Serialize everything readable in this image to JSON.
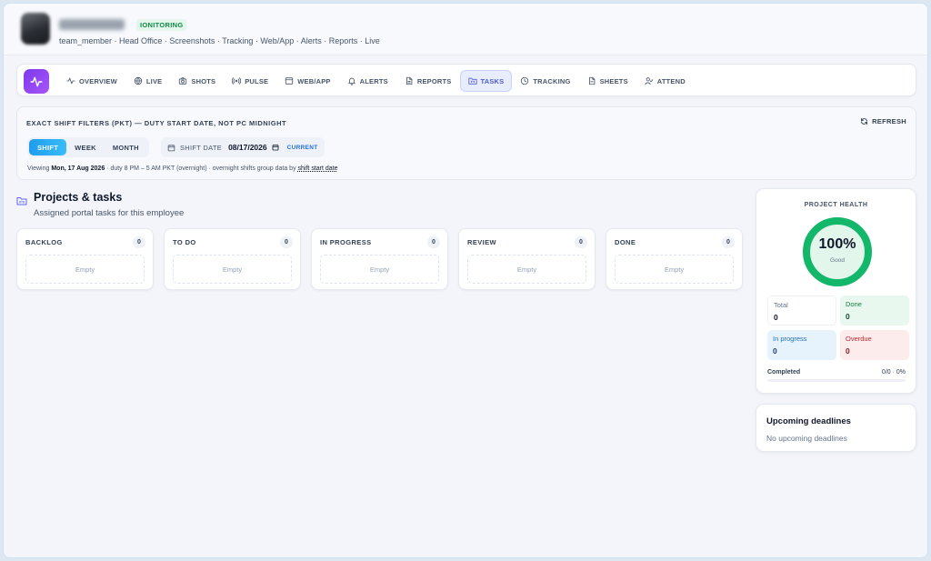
{
  "header": {
    "badge": "IONITORING",
    "subline": "team_member · Head Office · Screenshots · Tracking · Web/App · Alerts · Reports · Live"
  },
  "nav": {
    "tabs": [
      {
        "label": "OVERVIEW",
        "icon": "activity-icon"
      },
      {
        "label": "LIVE",
        "icon": "globe-icon"
      },
      {
        "label": "SHOTS",
        "icon": "camera-icon"
      },
      {
        "label": "PULSE",
        "icon": "radio-icon"
      },
      {
        "label": "WEB/APP",
        "icon": "browser-window-icon"
      },
      {
        "label": "ALERTS",
        "icon": "bell-icon"
      },
      {
        "label": "REPORTS",
        "icon": "document-icon"
      },
      {
        "label": "TASKS",
        "icon": "kanban-icon",
        "active": true
      },
      {
        "label": "TRACKING",
        "icon": "clock-icon"
      },
      {
        "label": "SHEETS",
        "icon": "sheet-icon"
      },
      {
        "label": "ATTEND",
        "icon": "user-check-icon"
      }
    ]
  },
  "filters": {
    "title": "EXACT SHIFT FILTERS (PKT) — DUTY START DATE, NOT PC MIDNIGHT",
    "refresh_label": "REFRESH",
    "periods": [
      "SHIFT",
      "WEEK",
      "MONTH"
    ],
    "active_period": "SHIFT",
    "shift_date_label": "SHIFT DATE",
    "shift_date_value": "08/17/2026",
    "current_label": "CURRENT",
    "viewing_prefix": "Viewing ",
    "viewing_date": "Mon, 17 Aug 2026",
    "viewing_middle": " · duty 8 PM – 5 AM PKT (overnight) · overnight shifts group data by ",
    "viewing_link": "shift start date"
  },
  "projects": {
    "title": "Projects & tasks",
    "subtitle": "Assigned portal tasks for this employee",
    "columns": [
      {
        "title": "BACKLOG",
        "count": "0",
        "empty": "Empty"
      },
      {
        "title": "TO DO",
        "count": "0",
        "empty": "Empty"
      },
      {
        "title": "IN PROGRESS",
        "count": "0",
        "empty": "Empty"
      },
      {
        "title": "REVIEW",
        "count": "0",
        "empty": "Empty"
      },
      {
        "title": "DONE",
        "count": "0",
        "empty": "Empty"
      }
    ]
  },
  "health": {
    "title": "PROJECT HEALTH",
    "percent": "100%",
    "percent_value": 1.0,
    "status": "Good",
    "ring_color": "#12b76a",
    "stats": {
      "total_label": "Total",
      "total_value": "0",
      "done_label": "Done",
      "done_value": "0",
      "progress_label": "In progress",
      "progress_value": "0",
      "overdue_label": "Overdue",
      "overdue_value": "0"
    },
    "completed_label": "Completed",
    "completed_value": "0/0 · 0%",
    "completed_fraction": 0
  },
  "deadlines": {
    "title": "Upcoming deadlines",
    "empty": "No upcoming deadlines"
  }
}
